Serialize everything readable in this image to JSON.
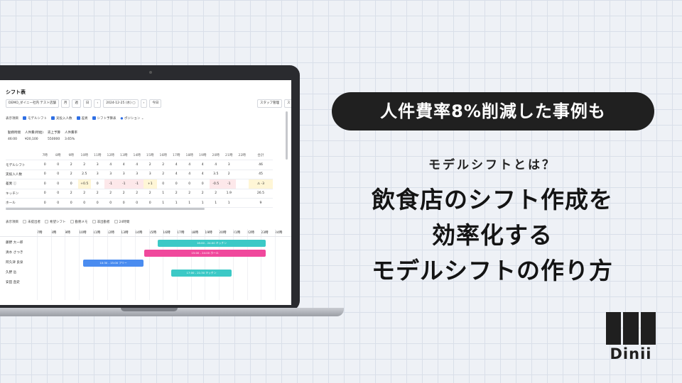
{
  "banner": {
    "pill": "人件費率8%削減した事例も",
    "subtitle": "モデルシフトとは？",
    "headline": [
      "飲食店のシフト作成を",
      "効率化する",
      "モデルシフトの作り方"
    ],
    "logo_text": "Dinii"
  },
  "app": {
    "title": "シフト表",
    "store_select": "DEMO_ダイニー社内 テスト店舗",
    "view_month": "月",
    "view_week": "週",
    "view_day": "日",
    "date": "2024-12-25 (水)",
    "today": "今日",
    "staff_manage": "スタッフ管理",
    "display_items_label": "表示項目",
    "checks": [
      "モデルシフト",
      "実投入人数",
      "差異",
      "シフト予算表",
      "ポジション"
    ],
    "stats_headers": [
      "勤務時間",
      "人件費(時給)",
      "売上予算",
      "人件費率"
    ],
    "stats_values": [
      "46:00",
      "¥20,100",
      "550000",
      "3.65%"
    ],
    "hours": [
      "7時",
      "8時",
      "9時",
      "10時",
      "11時",
      "12時",
      "13時",
      "14時",
      "15時",
      "16時",
      "17時",
      "18時",
      "19時",
      "20時",
      "21時",
      "22時"
    ],
    "total_label": "合計",
    "rows": [
      {
        "label": "モデルシフト",
        "vals": [
          "0",
          "0",
          "2",
          "2",
          "3",
          "4",
          "4",
          "4",
          "2",
          "2",
          "4",
          "4",
          "4",
          "4",
          "3",
          ""
        ],
        "total": "46"
      },
      {
        "label": "実投入人数",
        "vals": [
          "0",
          "0",
          "2",
          "2.5",
          "3",
          "3",
          "3",
          "3",
          "3",
          "2",
          "4",
          "4",
          "4",
          "3.5",
          "2",
          ""
        ],
        "total": "45"
      },
      {
        "label": "差異 ⓘ",
        "vals": [
          "0",
          "0",
          "0",
          "+0.5",
          "0",
          "-1",
          "-1",
          "-1",
          "+1",
          "0",
          "0",
          "0",
          "0",
          "-0.5",
          "-1",
          ""
        ],
        "total": "⚠ -3"
      },
      {
        "label": "キッチン",
        "vals": [
          "0",
          "0",
          "2",
          "2",
          "2",
          "2",
          "2",
          "2",
          "2",
          "1",
          "2",
          "2",
          "2",
          "2",
          "1.9",
          ""
        ],
        "total": "26.5"
      },
      {
        "label": "ホール",
        "vals": [
          "0",
          "0",
          "0",
          "0",
          "0",
          "0",
          "0",
          "0",
          "0",
          "1",
          "1",
          "1",
          "1",
          "1",
          "1",
          ""
        ],
        "total": "9"
      }
    ],
    "sec2_label": "表示項目",
    "sec2_items": [
      "未提出者",
      "希望シフト",
      "勤務メモ",
      "非出勤者",
      "24時間"
    ],
    "hours2": [
      "7時",
      "8時",
      "9時",
      "10時",
      "11時",
      "12時",
      "13時",
      "14時",
      "15時",
      "16時",
      "17時",
      "18時",
      "19時",
      "20時",
      "21時",
      "22時",
      "23時",
      "24時"
    ],
    "staff": [
      "藤野 大一郎",
      "清水 さつき",
      "阿久津 良泉",
      "久野 岳",
      "安田 直史"
    ],
    "shift_bars": [
      {
        "label": "16:00 - 24:00 キッチン",
        "color": "#3cc9c6"
      },
      {
        "label": "15:00 - 24:00 ホール",
        "color": "#f0489c"
      },
      {
        "label": "10:30 - 15:00 フリー",
        "color": "#4a8cf0"
      },
      {
        "label": "17:00 - 21:30 キッチン",
        "color": "#3cc9c6"
      }
    ]
  },
  "colors": {
    "accent": "#2f6fe4",
    "pill_bg": "#202020",
    "background": "#eef1f6"
  }
}
